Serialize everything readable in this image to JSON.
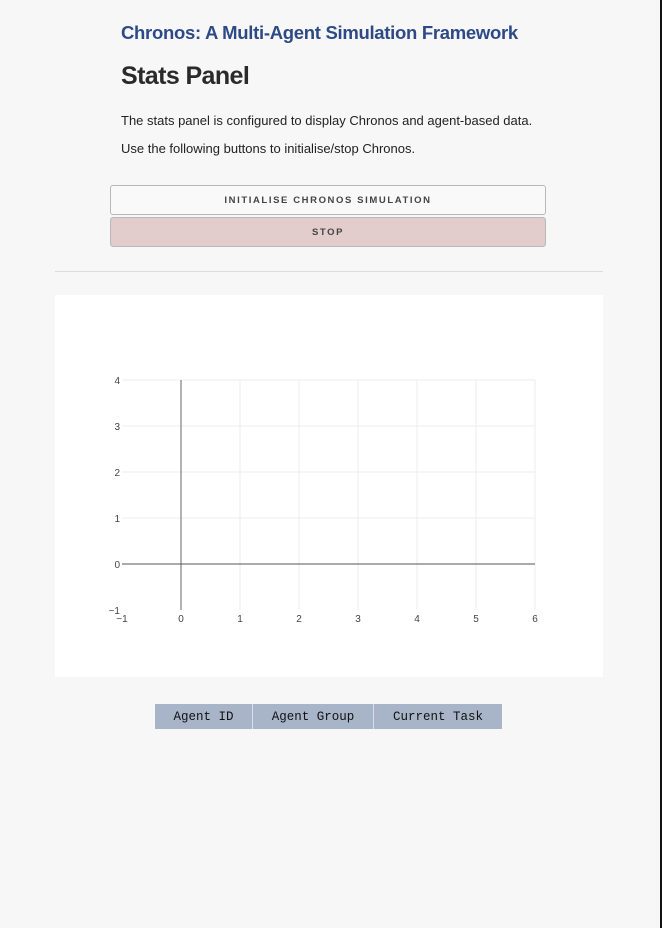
{
  "header": {
    "app_title": "Chronos: A Multi-Agent Simulation Framework",
    "page_title": "Stats Panel",
    "description": [
      "The stats panel is configured to display Chronos and agent-based data.",
      "Use the following buttons to initialise/stop Chronos."
    ]
  },
  "buttons": {
    "initialise_label": "INITIALISE CHRONOS SIMULATION",
    "stop_label": "STOP",
    "stop_color": "#e2cccc"
  },
  "chart_data": {
    "type": "scatter",
    "series": [],
    "xlim": [
      -1,
      6
    ],
    "ylim": [
      -1,
      4
    ],
    "xticks": [
      "−1",
      "0",
      "1",
      "2",
      "3",
      "4",
      "5",
      "6"
    ],
    "yticks": [
      "−1",
      "0",
      "1",
      "2",
      "3",
      "4"
    ],
    "grid": true,
    "title": "",
    "xlabel": "",
    "ylabel": ""
  },
  "table": {
    "columns": [
      "Agent ID",
      "Agent Group",
      "Current Task"
    ],
    "rows": []
  }
}
